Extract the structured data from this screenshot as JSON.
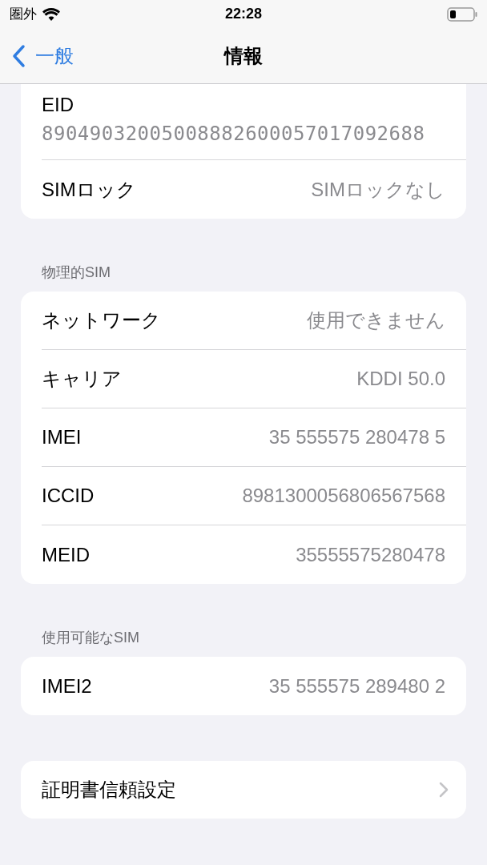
{
  "status_bar": {
    "carrier": "圏外",
    "time": "22:28"
  },
  "nav": {
    "back": "一般",
    "title": "情報"
  },
  "sections": [
    {
      "cut_top": true,
      "rows": [
        {
          "kind": "stacked",
          "label": "EID",
          "value": "89049032005008882600057017092688"
        },
        {
          "kind": "value",
          "label": "SIMロック",
          "value": "SIMロックなし"
        }
      ]
    },
    {
      "header": "物理的SIM",
      "rows": [
        {
          "kind": "value",
          "label": "ネットワーク",
          "value": "使用できません"
        },
        {
          "kind": "value",
          "label": "キャリア",
          "value": "KDDI 50.0"
        },
        {
          "kind": "value",
          "label": "IMEI",
          "value": "35 555575 280478 5"
        },
        {
          "kind": "value",
          "label": "ICCID",
          "value": "8981300056806567568"
        },
        {
          "kind": "value",
          "label": "MEID",
          "value": "35555575280478"
        }
      ]
    },
    {
      "header": "使用可能なSIM",
      "rows": [
        {
          "kind": "value",
          "label": "IMEI2",
          "value": "35 555575 289480 2"
        }
      ]
    },
    {
      "rows": [
        {
          "kind": "link",
          "label": "証明書信頼設定"
        }
      ]
    }
  ]
}
